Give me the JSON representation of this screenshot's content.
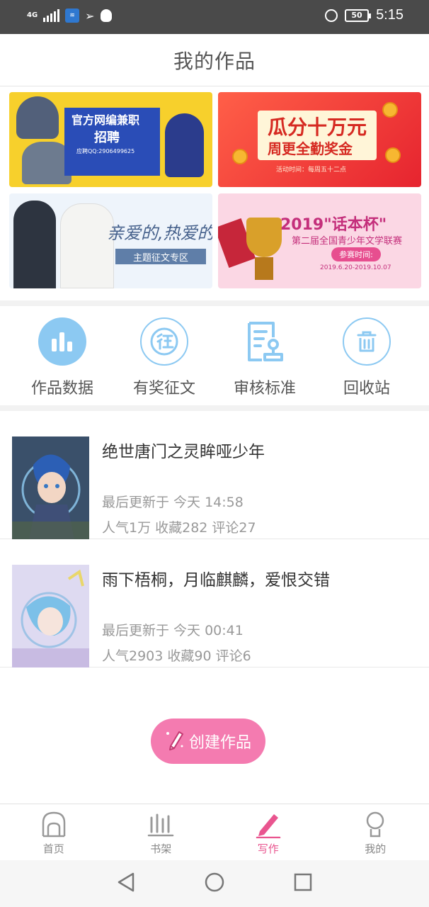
{
  "status_bar": {
    "network": "4G",
    "battery": "50",
    "time": "5:15",
    "icons": [
      "signal-icon",
      "wifi-icon",
      "send-icon",
      "qq-icon",
      "alarm-icon",
      "battery-icon"
    ]
  },
  "header": {
    "title": "我的作品"
  },
  "banners": [
    {
      "name": "banner-recruit",
      "line1": "官方网编兼职",
      "line2": "招聘",
      "line3": "应聘QQ:2906499625"
    },
    {
      "name": "banner-reward",
      "line1": "瓜分十万元",
      "line2": "周更全勤奖金",
      "line3": "活动时间：每周五十二点"
    },
    {
      "name": "banner-theme",
      "line1": "亲爱的,热爱的",
      "tag": "主题征文专区"
    },
    {
      "name": "banner-contest",
      "line1": "2019\"话本杯\"",
      "line2": "第二届全国青少年文学联赛",
      "tag": "参赛时间:",
      "line3": "2019.6.20-2019.10.07"
    }
  ],
  "quick_menu": [
    {
      "label": "作品数据",
      "icon": "bar-chart-icon"
    },
    {
      "label": "有奖征文",
      "icon": "contest-icon"
    },
    {
      "label": "审核标准",
      "icon": "review-standard-icon"
    },
    {
      "label": "回收站",
      "icon": "trash-icon"
    }
  ],
  "works": [
    {
      "title": "绝世唐门之灵眸哑少年",
      "updated": "最后更新于 今天 14:58",
      "stats": "人气1万 收藏282 评论27"
    },
    {
      "title": "雨下梧桐，月临麒麟，爱恨交错",
      "updated": "最后更新于 今天 00:41",
      "stats": "人气2903 收藏90 评论6"
    }
  ],
  "create_button": {
    "label": "创建作品",
    "icon": "pencil-icon"
  },
  "tabs": [
    {
      "label": "首页",
      "icon": "home-icon",
      "active": false
    },
    {
      "label": "书架",
      "icon": "bookshelf-icon",
      "active": false
    },
    {
      "label": "写作",
      "icon": "write-icon",
      "active": true
    },
    {
      "label": "我的",
      "icon": "profile-icon",
      "active": false
    }
  ],
  "colors": {
    "accent": "#e9558f",
    "button": "#f47bb0",
    "icon_blue": "#8cc9f2"
  }
}
